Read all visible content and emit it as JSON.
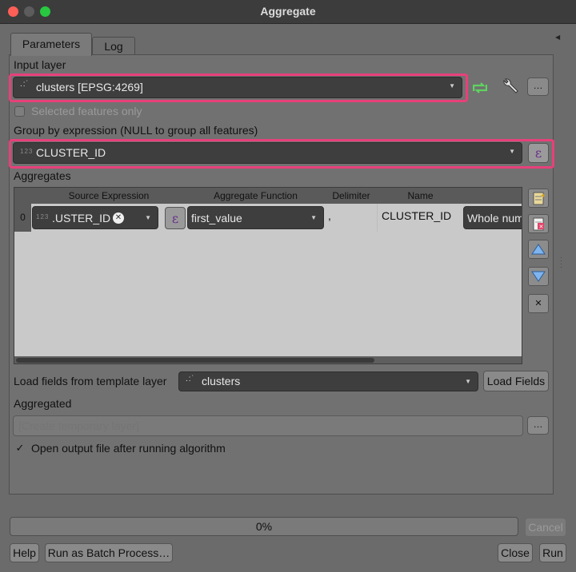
{
  "window": {
    "title": "Aggregate"
  },
  "tabs": [
    {
      "label": "Parameters",
      "active": true
    },
    {
      "label": "Log",
      "active": false
    }
  ],
  "input_layer": {
    "label": "Input layer",
    "value": "clusters [EPSG:4269]",
    "selected_only_label": "Selected features only",
    "selected_only_checked": false
  },
  "group_by": {
    "label": "Group by expression (NULL to group all features)",
    "value": "CLUSTER_ID",
    "type_hint": "123"
  },
  "aggregates": {
    "label": "Aggregates",
    "columns": [
      "Source Expression",
      "Aggregate Function",
      "Delimiter",
      "Name"
    ],
    "rows": [
      {
        "index": "0",
        "source": ".USTER_ID",
        "type_hint": "123",
        "function": "first_value",
        "delimiter": ",",
        "name": "CLUSTER_ID",
        "type": "Whole num"
      }
    ]
  },
  "template": {
    "label": "Load fields from template layer",
    "value": "clusters",
    "button": "Load Fields"
  },
  "output": {
    "label": "Aggregated",
    "placeholder": "[Create temporary layer]",
    "browse": "…"
  },
  "open_after": {
    "label": "Open output file after running algorithm",
    "checked": true
  },
  "progress": {
    "value_text": "0%",
    "fraction": 0
  },
  "buttons": {
    "cancel": "Cancel",
    "help": "Help",
    "batch": "Run as Batch Process…",
    "close": "Close",
    "run": "Run"
  },
  "colors": {
    "highlight": "#e8407a",
    "window_bg": "#6b6b6b",
    "combo_bg": "#3e3e3e",
    "reload_green": "#5fd35f"
  }
}
